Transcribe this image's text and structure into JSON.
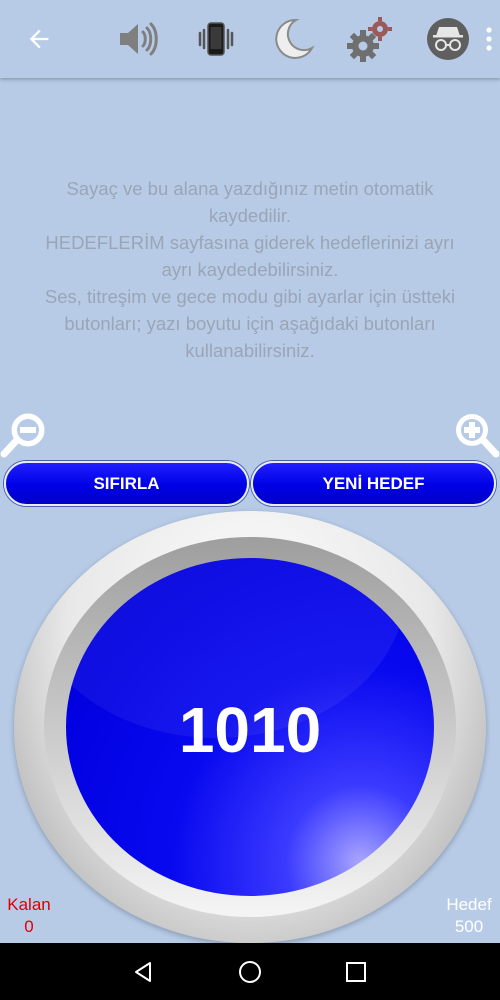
{
  "toolbar": {
    "back_icon": "arrow-left-icon",
    "icons": [
      "speaker-icon",
      "vibrate-icon",
      "moon-icon",
      "gears-icon",
      "incognito-icon",
      "overflow-menu-icon"
    ]
  },
  "info": {
    "lines": [
      "Sayaç ve bu alana yazdığınız metin otomatik",
      "kaydedilir.",
      "HEDEFLERİM sayfasına giderek hedeflerinizi ayrı",
      "ayrı kaydedebilirsiniz.",
      "Ses, titreşim ve gece modu gibi ayarlar için üstteki",
      "butonları; yazı boyutu için aşağıdaki butonları",
      "kullanabilirsiniz."
    ]
  },
  "zoom": {
    "out_icon": "zoom-out-icon",
    "in_icon": "zoom-in-icon"
  },
  "buttons": {
    "reset_label": "SIFIRLA",
    "new_goal_label": "YENİ HEDEF"
  },
  "counter": {
    "value": "1010"
  },
  "remaining": {
    "label": "Kalan",
    "value": "0"
  },
  "target": {
    "label": "Hedef",
    "value": "500"
  },
  "colors": {
    "background": "#b7cbe7",
    "button_blue": "#0000e6",
    "remaining_red": "#e00000",
    "target_white": "#ffffff"
  }
}
